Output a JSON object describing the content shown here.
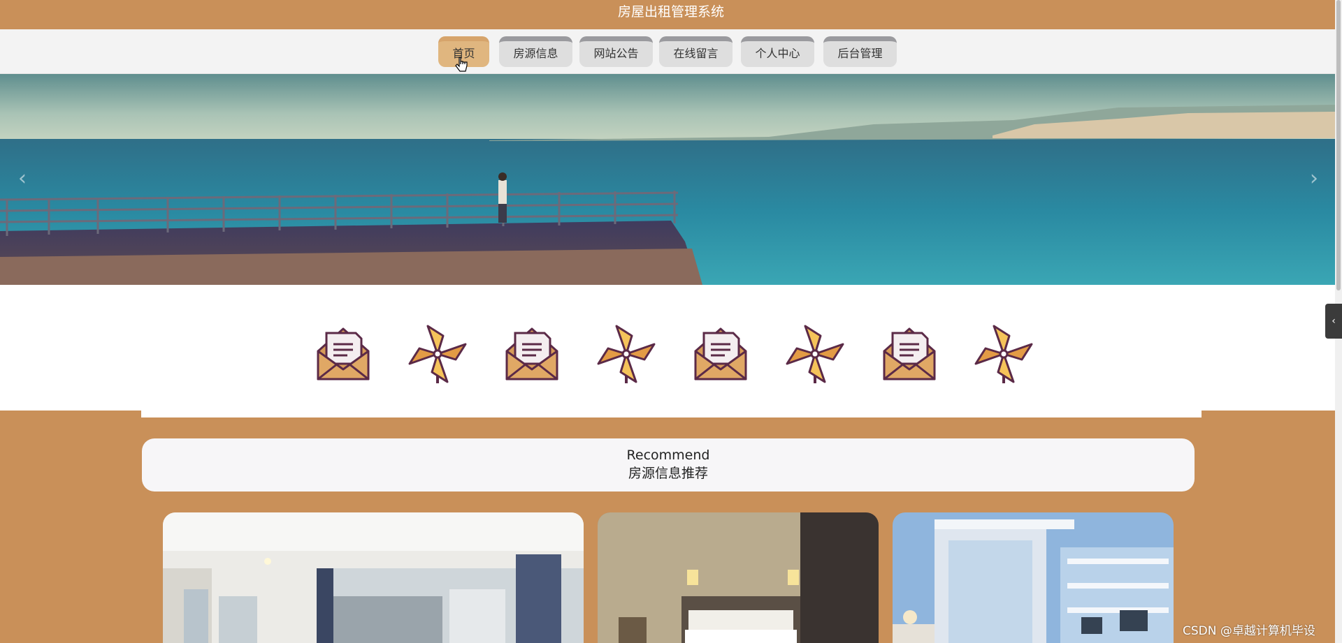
{
  "app": {
    "title": "房屋出租管理系统"
  },
  "nav": {
    "items": [
      {
        "label": "首页",
        "active": true
      },
      {
        "label": "房源信息",
        "active": false
      },
      {
        "label": "网站公告",
        "active": false
      },
      {
        "label": "在线留言",
        "active": false
      },
      {
        "label": "个人中心",
        "active": false
      },
      {
        "label": "后台管理",
        "active": false
      }
    ]
  },
  "banner": {
    "prev_icon": "chevron-left-icon",
    "next_icon": "chevron-right-icon"
  },
  "quick_icons": [
    "envelope-icon",
    "pinwheel-icon",
    "envelope-icon",
    "pinwheel-icon",
    "envelope-icon",
    "pinwheel-icon",
    "envelope-icon",
    "pinwheel-icon"
  ],
  "recommend": {
    "title_en": "Recommend",
    "title_cn": "房源信息推荐"
  },
  "watermark": "CSDN @卓越计算机毕设",
  "colors": {
    "brand": "#c99059",
    "nav_active": "#e0b67f",
    "nav_bg": "#f3f3f3"
  }
}
